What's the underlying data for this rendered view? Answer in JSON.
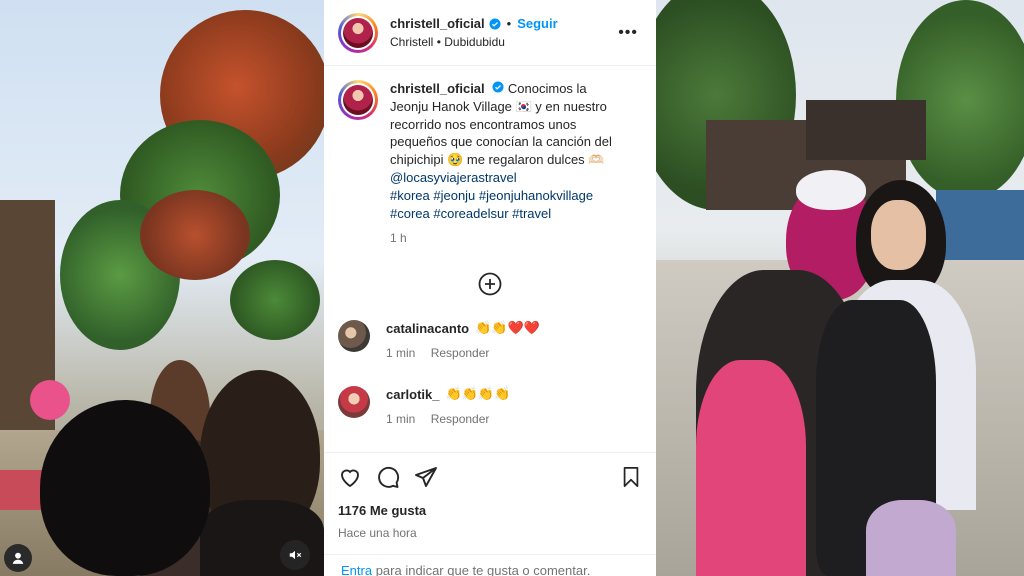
{
  "post": {
    "username": "christell_oficial",
    "follow_label": "Seguir",
    "audio_artist": "Christell",
    "audio_separator": "•",
    "audio_track": "Dubidubidu",
    "more_label": "•••",
    "caption": {
      "username": "christell_oficial",
      "text": "Conocimos la Jeonju Hanok Village 🇰🇷 y en nuestro recorrido nos encontramos unos pequeños que conocían la canción del chipichipi 🥹 me regalaron dulces 🫶🏻",
      "mention": "@locasyviajerastravel",
      "hashtags": "#korea #jeonju #jeonjuhanokvillage #corea #coreadelsur #travel",
      "time": "1 h"
    },
    "comments": [
      {
        "username": "catalinacanto",
        "text": "👏👏❤️❤️",
        "time": "1 min",
        "reply": "Responder"
      },
      {
        "username": "carlotik_",
        "text": "👏👏👏👏",
        "time": "1 min",
        "reply": "Responder"
      }
    ],
    "likes": "1176 Me gusta",
    "posted": "Hace una hora",
    "prompt_link": "Entra",
    "prompt_text": "para indicar que te gusta o comentar."
  },
  "icons": {
    "verified": "verified-badge-icon",
    "add": "add-circle-icon",
    "like": "heart-icon",
    "comment": "comment-bubble-icon",
    "share": "paper-plane-icon",
    "save": "bookmark-icon",
    "mute": "speaker-muted-icon",
    "user": "user-icon"
  },
  "colors": {
    "accent": "#0095f6",
    "verified": "#0095f6",
    "muted_text": "#737373",
    "link": "#00376b"
  }
}
